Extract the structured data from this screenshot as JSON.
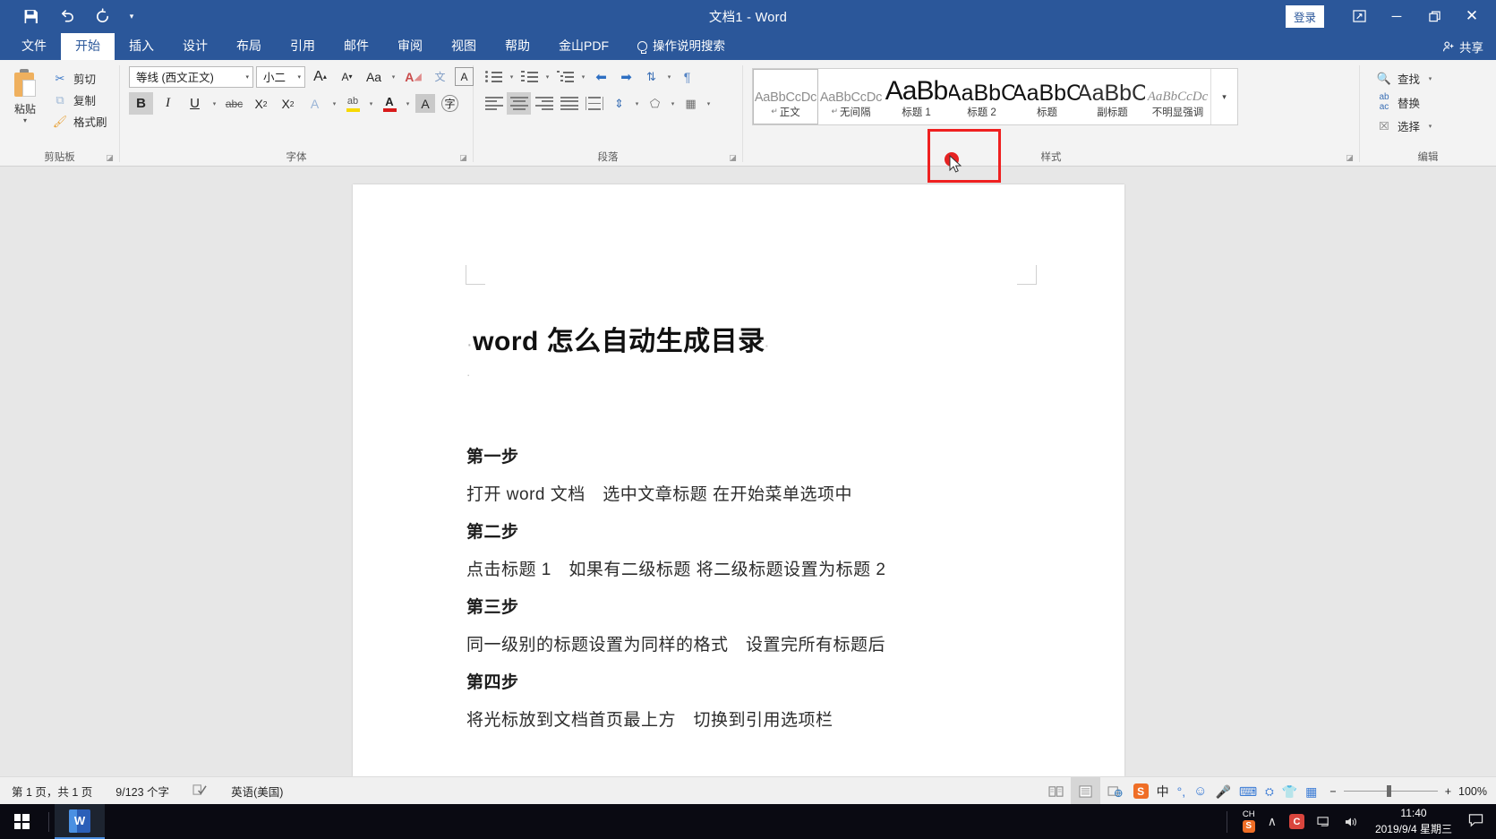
{
  "titlebar": {
    "title": "文档1  -  Word",
    "qat": [
      {
        "name": "save",
        "glyph": "💾"
      },
      {
        "name": "undo",
        "glyph": "↶"
      },
      {
        "name": "redo",
        "glyph": "↻"
      },
      {
        "name": "customize",
        "glyph": "▾"
      }
    ],
    "login_label": "登录",
    "ribbon_display_glyph": "⬚",
    "minimize_glyph": "─",
    "restore_glyph": "❐",
    "close_glyph": "✕",
    "share_label": "共享"
  },
  "tabs": [
    {
      "label": "文件",
      "active": false
    },
    {
      "label": "开始",
      "active": true
    },
    {
      "label": "插入",
      "active": false
    },
    {
      "label": "设计",
      "active": false
    },
    {
      "label": "布局",
      "active": false
    },
    {
      "label": "引用",
      "active": false
    },
    {
      "label": "邮件",
      "active": false
    },
    {
      "label": "审阅",
      "active": false
    },
    {
      "label": "视图",
      "active": false
    },
    {
      "label": "帮助",
      "active": false
    },
    {
      "label": "金山PDF",
      "active": false
    }
  ],
  "tell_me": "操作说明搜索",
  "ribbon": {
    "clipboard": {
      "group_label": "剪贴板",
      "paste_label": "粘贴",
      "commands": [
        {
          "label": "剪切",
          "icon": "scissors-icon",
          "glyph": "✂"
        },
        {
          "label": "复制",
          "icon": "copy-icon",
          "glyph": "⧉"
        },
        {
          "label": "格式刷",
          "icon": "format-painter-icon",
          "glyph": "🖌"
        }
      ]
    },
    "font": {
      "group_label": "字体",
      "font_name": "等线 (西文正文)",
      "font_size": "小二",
      "grow_font": "A",
      "shrink_font": "A",
      "change_case": "Aa",
      "clear_format": "A",
      "phonetic": "文",
      "char_border": "A",
      "bold": "B",
      "italic": "I",
      "underline": "U",
      "strikethrough": "abc",
      "subscript": "X",
      "superscript": "X",
      "text_effects": "A",
      "highlight": "ab",
      "font_color": "A",
      "char_shading": "A",
      "enclose_char": "字"
    },
    "paragraph": {
      "group_label": "段落",
      "bullets": "bullet-list-icon",
      "numbering": "numbered-list-icon",
      "multilevel": "multilevel-list-icon",
      "decrease_indent": "decrease-indent-icon",
      "increase_indent": "increase-indent-icon",
      "sort": "sort-icon",
      "show_marks": "show-paragraph-marks-icon",
      "align_left": "align-left-icon",
      "align_center": "align-center-icon",
      "align_right": "align-right-icon",
      "justify": "justify-icon",
      "distribute": "distribute-icon",
      "line_spacing": "line-spacing-icon",
      "shading": "shading-icon",
      "borders": "borders-icon"
    },
    "styles": {
      "group_label": "样式",
      "items": [
        {
          "preview": "AaBbCcDc",
          "name": "正文",
          "pilcrow": true,
          "kind": "normal",
          "selected": true,
          "highlighted": false
        },
        {
          "preview": "AaBbCcDc",
          "name": "无间隔",
          "pilcrow": true,
          "kind": "normal",
          "selected": false,
          "highlighted": false
        },
        {
          "preview": "AaBb",
          "name": "标题 1",
          "pilcrow": false,
          "kind": "h1",
          "selected": false,
          "highlighted": true
        },
        {
          "preview": "AaBbC",
          "name": "标题 2",
          "pilcrow": false,
          "kind": "h2",
          "selected": false,
          "highlighted": false
        },
        {
          "preview": "AaBbC",
          "name": "标题",
          "pilcrow": false,
          "kind": "title",
          "selected": false,
          "highlighted": false
        },
        {
          "preview": "AaBbC",
          "name": "副标题",
          "pilcrow": false,
          "kind": "sub",
          "selected": false,
          "highlighted": false
        },
        {
          "preview": "AaBbCcDc",
          "name": "不明显强调",
          "pilcrow": false,
          "kind": "em",
          "selected": false,
          "highlighted": false
        }
      ],
      "more_glyph": "▾"
    },
    "editing": {
      "group_label": "编辑",
      "commands": [
        {
          "label": "查找",
          "icon": "magnifier-icon",
          "glyph": "🔍",
          "caret": true
        },
        {
          "label": "替换",
          "icon": "replace-icon",
          "glyph": "ab",
          "caret": false
        },
        {
          "label": "选择",
          "icon": "select-arrow-icon",
          "glyph": "➤",
          "caret": true
        }
      ]
    }
  },
  "document": {
    "heading": "word 怎么自动生成目录",
    "blocks": [
      {
        "type": "step",
        "text": "第一步"
      },
      {
        "type": "para",
        "text": "打开 word 文档　选中文章标题 在开始菜单选项中"
      },
      {
        "type": "step",
        "text": "第二步"
      },
      {
        "type": "para",
        "text": "点击标题 1　如果有二级标题 将二级标题设置为标题 2"
      },
      {
        "type": "step",
        "text": "第三步"
      },
      {
        "type": "para",
        "text": "同一级别的标题设置为同样的格式　设置完所有标题后"
      },
      {
        "type": "step",
        "text": "第四步"
      },
      {
        "type": "para",
        "text": "将光标放到文档首页最上方　切换到引用选项栏"
      }
    ]
  },
  "statusbar": {
    "page_info": "第 1 页，共 1 页",
    "word_count": "9/123 个字",
    "proofing_icon": "spell-check-icon",
    "language": "英语(美国)",
    "views": [
      {
        "name": "read-mode",
        "glyph": "📖",
        "active": false
      },
      {
        "name": "print-layout",
        "glyph": "☰",
        "active": true
      },
      {
        "name": "web-layout",
        "glyph": "🌐",
        "active": false
      }
    ],
    "zoom_out": "−",
    "zoom_in": "+",
    "zoom_level": "100%"
  },
  "ime_tray": [
    {
      "name": "sogou-logo-icon",
      "glyph": "S"
    },
    {
      "name": "chinese-mode-icon",
      "glyph": "中"
    },
    {
      "name": "punctuation-icon",
      "glyph": "°,"
    },
    {
      "name": "emoji-icon",
      "glyph": "☺"
    },
    {
      "name": "voice-input-icon",
      "glyph": "🎤"
    },
    {
      "name": "soft-keyboard-icon",
      "glyph": "⌨"
    },
    {
      "name": "toolbox-icon",
      "glyph": "🧰"
    },
    {
      "name": "skin-icon",
      "glyph": "👕"
    },
    {
      "name": "more-apps-icon",
      "glyph": "░"
    }
  ],
  "taskbar": {
    "start_icon": "windows-logo-icon",
    "apps": [
      {
        "name": "word-taskbar-item",
        "glyph": "W"
      }
    ],
    "tray": {
      "ime_label": "CH",
      "sogou_label": "S",
      "show_hidden_glyph": "∧",
      "cred_label": "C",
      "network_glyph": "🖥",
      "volume_glyph": "🔊",
      "time": "11:40",
      "date": "2019/9/4 星期三",
      "notification_glyph": "🗪"
    }
  }
}
